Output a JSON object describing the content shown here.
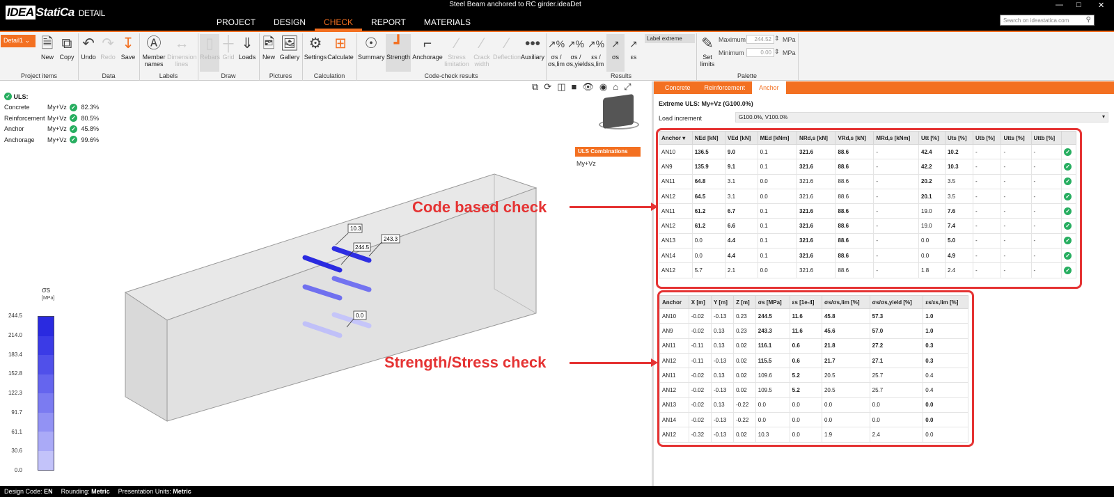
{
  "app": {
    "logo_brand": "IDEA",
    "logo_name": "StatiCa",
    "logo_sub": "DETAIL",
    "window_title": "Steel Beam anchored to RC girder.ideaDet",
    "search_placeholder": "Search on ideastatica.com",
    "menu": [
      "PROJECT",
      "DESIGN",
      "CHECK",
      "REPORT",
      "MATERIALS"
    ],
    "active_menu": "CHECK"
  },
  "ribbon": {
    "detail_selector": "Detail1",
    "buttons": {
      "new": "New",
      "copy": "Copy",
      "undo": "Undo",
      "redo": "Redo",
      "save": "Save",
      "member_names": "Member names",
      "dimension_lines": "Dimension lines",
      "rebars": "Rebars",
      "grid": "Grid",
      "loads": "Loads",
      "pic_new": "New",
      "gallery": "Gallery",
      "settings": "Settings",
      "calculate": "Calculate",
      "summary": "Summary",
      "strength": "Strength",
      "anchorage": "Anchorage",
      "stress_limitation": "Stress limitation",
      "crack_width": "Crack width",
      "deflection": "Deflection",
      "auxiliary": "Auxiliary",
      "res1": "σs / σs,lim",
      "res2": "σs / σs,yield",
      "res3": "εs / εs,lim",
      "res4": "σs",
      "res5": "εs",
      "label_extreme": "Label extreme",
      "set_limits": "Set limits"
    },
    "groups": {
      "project_items": "Project items",
      "data": "Data",
      "labels": "Labels",
      "draw": "Draw",
      "pictures": "Pictures",
      "calculation": "Calculation",
      "code_check_results": "Code-check results",
      "results": "Results",
      "palette": "Palette"
    },
    "palette": {
      "max_label": "Maximum",
      "max_value": "244.52",
      "min_label": "Minimum",
      "min_value": "0.00",
      "unit": "MPa"
    }
  },
  "uls_summary": {
    "title": "ULS:",
    "rows": [
      {
        "name": "Concrete",
        "comb": "My+Vz",
        "value": "82.3%"
      },
      {
        "name": "Reinforcement",
        "comb": "My+Vz",
        "value": "80.5%"
      },
      {
        "name": "Anchor",
        "comb": "My+Vz",
        "value": "45.8%"
      },
      {
        "name": "Anchorage",
        "comb": "My+Vz",
        "value": "99.6%"
      }
    ]
  },
  "tree": {
    "uls_combinations": "ULS Combinations",
    "item": "My+Vz"
  },
  "model_labels": [
    "10.3",
    "244.5",
    "243.3",
    "0.0"
  ],
  "legend": {
    "symbol": "σs",
    "unit": "[MPa]",
    "ticks": [
      "244.5",
      "214.0",
      "183.4",
      "152.8",
      "122.3",
      "91.7",
      "61.1",
      "30.6",
      "0.0"
    ],
    "colors": [
      "#2a2ae0",
      "#3b3be6",
      "#5050ea",
      "#6565ee",
      "#7b7bf1",
      "#9292f4",
      "#aaaaf7",
      "#c3c3fa",
      "#dedefc"
    ]
  },
  "panel": {
    "tabs": [
      "Concrete",
      "Reinforcement",
      "Anchor"
    ],
    "active_tab": "Anchor",
    "extreme_title": "Extreme ULS: My+Vz (G100.0%)",
    "load_increment_label": "Load increment",
    "load_increment_value": "G100.0%, V100.0%"
  },
  "table1": {
    "headers": [
      "Anchor",
      "NEd [kN]",
      "VEd [kN]",
      "MEd [kNm]",
      "NRd,s [kN]",
      "VRd,s [kN]",
      "MRd,s [kNm]",
      "Utt [%]",
      "Uts [%]",
      "Utb [%]",
      "Utts [%]",
      "Uttb [%]",
      ""
    ],
    "rows": [
      [
        "AN10",
        "136.5",
        "9.0",
        "0.1",
        "321.6",
        "88.6",
        "-",
        "42.4",
        "10.2",
        "-",
        "-",
        "-"
      ],
      [
        "AN9",
        "135.9",
        "9.1",
        "0.1",
        "321.6",
        "88.6",
        "-",
        "42.2",
        "10.3",
        "-",
        "-",
        "-"
      ],
      [
        "AN11",
        "64.8",
        "3.1",
        "0.0",
        "321.6",
        "88.6",
        "-",
        "20.2",
        "3.5",
        "-",
        "-",
        "-"
      ],
      [
        "AN12",
        "64.5",
        "3.1",
        "0.0",
        "321.6",
        "88.6",
        "-",
        "20.1",
        "3.5",
        "-",
        "-",
        "-"
      ],
      [
        "AN11",
        "61.2",
        "6.7",
        "0.1",
        "321.6",
        "88.6",
        "-",
        "19.0",
        "7.6",
        "-",
        "-",
        "-"
      ],
      [
        "AN12",
        "61.2",
        "6.6",
        "0.1",
        "321.6",
        "88.6",
        "-",
        "19.0",
        "7.4",
        "-",
        "-",
        "-"
      ],
      [
        "AN13",
        "0.0",
        "4.4",
        "0.1",
        "321.6",
        "88.6",
        "-",
        "0.0",
        "5.0",
        "-",
        "-",
        "-"
      ],
      [
        "AN14",
        "0.0",
        "4.4",
        "0.1",
        "321.6",
        "88.6",
        "-",
        "0.0",
        "4.9",
        "-",
        "-",
        "-"
      ],
      [
        "AN12",
        "5.7",
        "2.1",
        "0.0",
        "321.6",
        "88.6",
        "-",
        "1.8",
        "2.4",
        "-",
        "-",
        "-"
      ]
    ]
  },
  "table2": {
    "headers": [
      "Anchor",
      "X [m]",
      "Y [m]",
      "Z [m]",
      "σs [MPa]",
      "εs [1e-4]",
      "σs/σs,lim [%]",
      "σs/σs,yield [%]",
      "εs/εs,lim [%]"
    ],
    "rows": [
      [
        "AN10",
        "-0.02",
        "-0.13",
        "0.23",
        "244.5",
        "11.6",
        "45.8",
        "57.3",
        "1.0"
      ],
      [
        "AN9",
        "-0.02",
        "0.13",
        "0.23",
        "243.3",
        "11.6",
        "45.6",
        "57.0",
        "1.0"
      ],
      [
        "AN11",
        "-0.11",
        "0.13",
        "0.02",
        "116.1",
        "0.6",
        "21.8",
        "27.2",
        "0.3"
      ],
      [
        "AN12",
        "-0.11",
        "-0.13",
        "0.02",
        "115.5",
        "0.6",
        "21.7",
        "27.1",
        "0.3"
      ],
      [
        "AN11",
        "-0.02",
        "0.13",
        "0.02",
        "109.6",
        "5.2",
        "20.5",
        "25.7",
        "0.4"
      ],
      [
        "AN12",
        "-0.02",
        "-0.13",
        "0.02",
        "109.5",
        "5.2",
        "20.5",
        "25.7",
        "0.4"
      ],
      [
        "AN13",
        "-0.02",
        "0.13",
        "-0.22",
        "0.0",
        "0.0",
        "0.0",
        "0.0",
        "0.0"
      ],
      [
        "AN14",
        "-0.02",
        "-0.13",
        "-0.22",
        "0.0",
        "0.0",
        "0.0",
        "0.0",
        "0.0"
      ],
      [
        "AN12",
        "-0.32",
        "-0.13",
        "0.02",
        "10.3",
        "0.0",
        "1.9",
        "2.4",
        "0.0"
      ]
    ]
  },
  "annotations": {
    "code_based": "Code based check",
    "strength": "Strength/Stress check"
  },
  "status": {
    "design_code_label": "Design Code:",
    "design_code": "EN",
    "rounding_label": "Rounding:",
    "rounding": "Metric",
    "units_label": "Presentation Units:",
    "units": "Metric"
  },
  "colors": {
    "accent": "#f37021",
    "highlight": "#e53333",
    "ok": "#27ae60"
  }
}
